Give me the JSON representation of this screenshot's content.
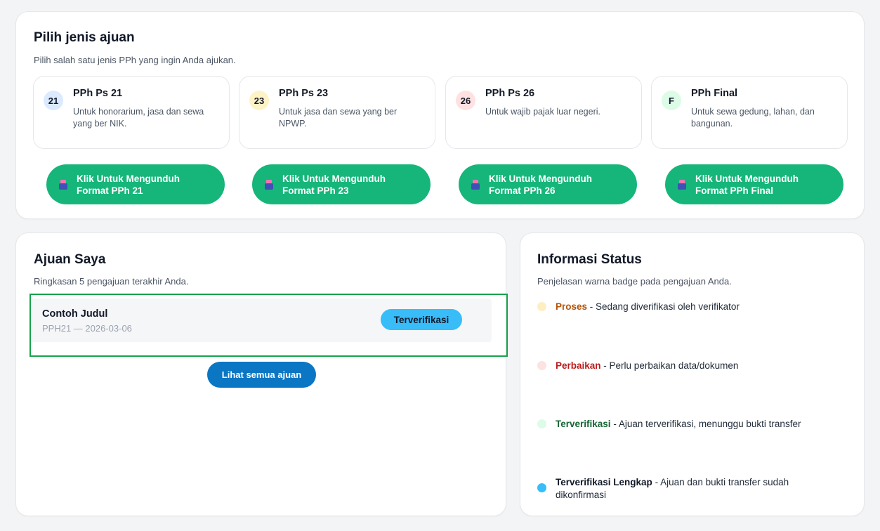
{
  "submission_types": {
    "title": "Pilih jenis ajuan",
    "subtitle": "Pilih salah satu jenis PPh yang ingin Anda ajukan.",
    "items": [
      {
        "badge": "21",
        "badge_color": "#dbeafe",
        "title": "PPh Ps 21",
        "description": "Untuk honorarium, jasa dan sewa yang ber NIK."
      },
      {
        "badge": "23",
        "badge_color": "#fef3c7",
        "title": "PPh Ps 23",
        "description": "Untuk jasa dan sewa yang ber NPWP."
      },
      {
        "badge": "26",
        "badge_color": "#fee2e2",
        "title": "PPh Ps 26",
        "description": "Untuk wajib pajak luar negeri."
      },
      {
        "badge": "F",
        "badge_color": "#dcfce7",
        "title": "PPh Final",
        "description": "Untuk sewa gedung, lahan, dan bangunan."
      }
    ],
    "download_buttons": [
      {
        "line1": "Klik Untuk Mengunduh",
        "line2": "Format PPh 21"
      },
      {
        "line1": "Klik Untuk Mengunduh",
        "line2": "Format PPh 23"
      },
      {
        "line1": "Klik Untuk Mengunduh",
        "line2": "Format PPh 26"
      },
      {
        "line1": "Klik Untuk Mengunduh",
        "line2": "Format PPh Final"
      }
    ],
    "download_icon": "document-download-icon",
    "button_color": "#16b67a"
  },
  "my_submissions": {
    "title": "Ajuan Saya",
    "subtitle": "Ringkasan 5 pengajuan terakhir Anda.",
    "items": [
      {
        "title": "Contoh Judul",
        "meta": "PPH21 — 2026-03-06",
        "status": "Terverifikasi",
        "status_color": "#38bdf8"
      }
    ],
    "see_all_label": "Lihat semua ajuan",
    "see_all_color": "#0b76c4"
  },
  "status_info": {
    "title": "Informasi Status",
    "subtitle": "Penjelasan warna badge pada pengajuan Anda.",
    "items": [
      {
        "key": "Proses",
        "desc": " - Sedang diverifikasi oleh verifikator",
        "dot_color": "#fdeec4",
        "key_color": "#b45309"
      },
      {
        "key": "Perbaikan",
        "desc": " - Perlu perbaikan data/dokumen",
        "dot_color": "#fde2e2",
        "key_color": "#b91c1c"
      },
      {
        "key": "Terverifikasi",
        "desc": " - Ajuan terverifikasi, menunggu bukti transfer",
        "dot_color": "#dcfce7",
        "key_color": "#166534"
      },
      {
        "key": "Terverifikasi Lengkap",
        "desc": " - Ajuan dan bukti transfer sudah dikonfirmasi",
        "dot_color": "#38bdf8",
        "key_color": "#111827"
      }
    ]
  }
}
